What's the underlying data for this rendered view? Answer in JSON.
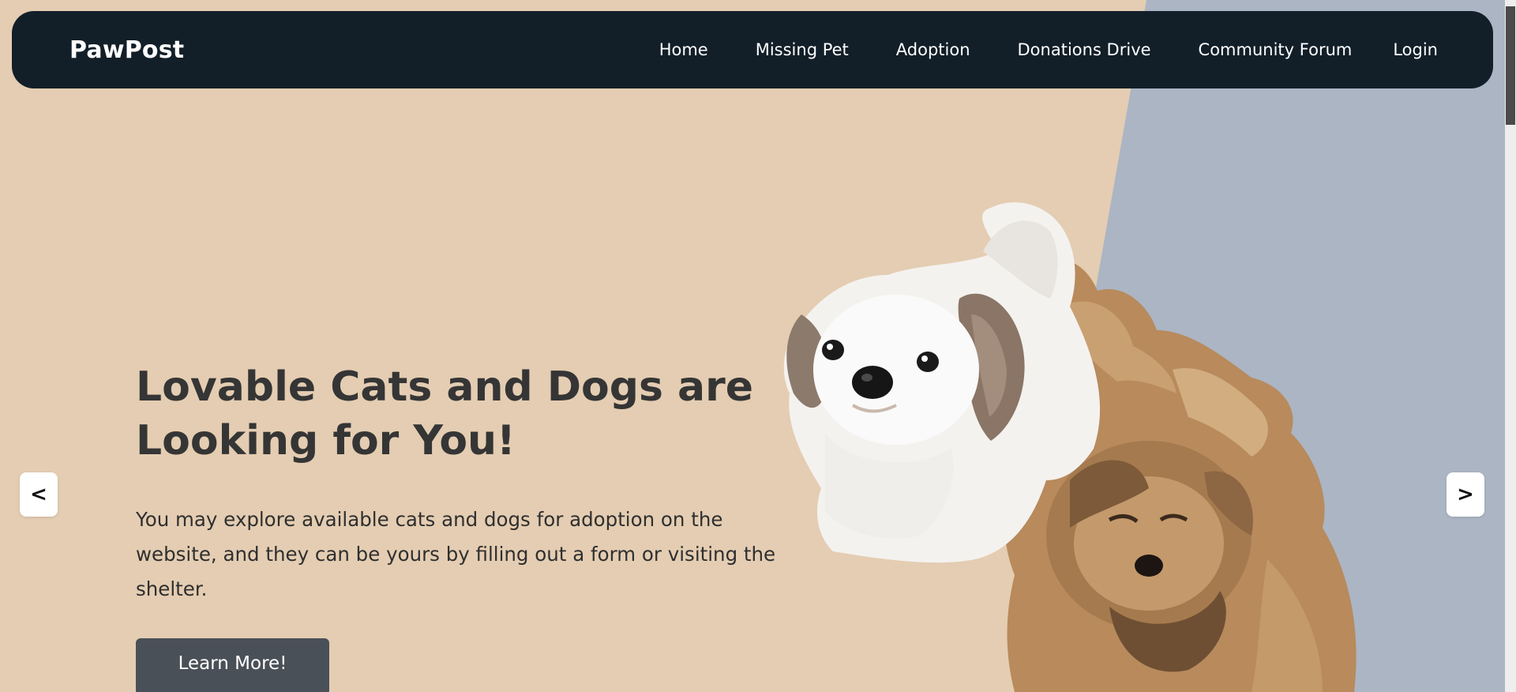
{
  "brand": "PawPost",
  "nav": {
    "home": "Home",
    "missing_pet": "Missing Pet",
    "adoption": "Adoption",
    "donations_drive": "Donations Drive",
    "community_forum": "Community Forum",
    "login": "Login"
  },
  "hero": {
    "title_line1": "Lovable Cats and Dogs are",
    "title_line2": "Looking for You!",
    "description": "You may explore available cats and dogs for adoption on the website, and they can be yours by filling out a form or visiting the shelter.",
    "cta_label": "Learn More!"
  },
  "carousel": {
    "prev_label": "<",
    "next_label": ">"
  },
  "colors": {
    "background_left": "#e4cdb2",
    "background_right": "#abb5c4",
    "navbar": "#121f29",
    "button": "#4a5057",
    "heading_text": "#353535"
  }
}
